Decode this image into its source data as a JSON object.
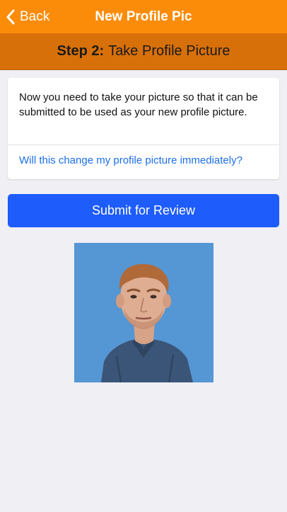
{
  "navbar": {
    "back_label": "Back",
    "back_icon": "chevron-left-icon",
    "title": "New Profile Pic",
    "color": "#fb8c0a"
  },
  "step": {
    "number_label": "Step 2:",
    "title": "Take Profile Picture",
    "color": "#d8700a"
  },
  "info_card": {
    "message": "Now you need to take your picture so that it can be submitted to be used as your new profile picture.",
    "faq_link": "Will this change my profile picture immediately?"
  },
  "submit_button": {
    "label": "Submit for Review",
    "color": "#1e5cfb"
  },
  "profile_photo": {
    "background": "#5596d4"
  }
}
